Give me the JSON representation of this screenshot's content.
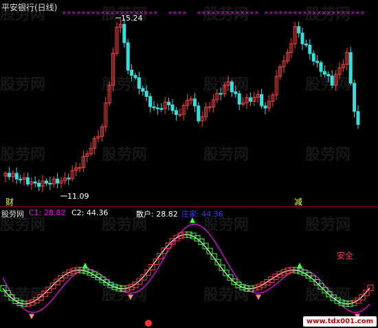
{
  "header": {
    "title": "平安银行(日线)"
  },
  "price_panel": {
    "max_price_label": "15.24",
    "min_price_label": "11.09",
    "buy_signal_label": "财",
    "sell_signal_label": "减"
  },
  "indicator": {
    "name": "股劳网",
    "c1_label": "C1:",
    "c1_value": "28.82",
    "c2_label": "C2:",
    "c2_value": "44.36",
    "retail_label": "散户:",
    "retail_value": "28.82",
    "dealer_label": "庄家:",
    "dealer_value": "44.36",
    "annotation": "安全"
  },
  "watermarks": [
    "股劳网",
    "股劳网",
    "股劳网",
    "股劳网",
    "股劳网",
    "股劳网",
    "股劳网",
    "股劳网",
    "股劳网",
    "股劳网",
    "股劳网",
    "股劳网",
    "股劳网",
    "股劳网",
    "股劳网",
    "股劳网",
    "股劳网",
    "股劳网",
    "股劳网",
    "股劳网"
  ],
  "site_badge": "www.tdx001.com",
  "colors": {
    "up": "#ff4040",
    "down": "#33e0e0",
    "c1": "#ff00ff",
    "c2": "#ffffff",
    "retail": "#ffffff",
    "dealer": "#3a3aff",
    "step_green": "#44ff44",
    "step_red": "#ff4040",
    "divider": "#8b0000"
  }
}
